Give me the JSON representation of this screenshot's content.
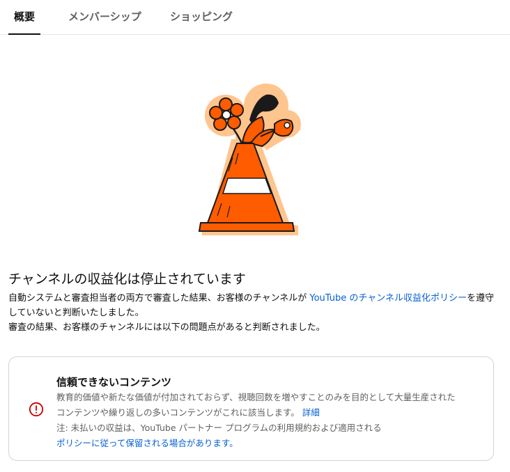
{
  "tabs": [
    {
      "label": "概要",
      "active": true
    },
    {
      "label": "メンバーシップ",
      "active": false
    },
    {
      "label": "ショッピング",
      "active": false
    }
  ],
  "illustration": {
    "icon": "traffic-cone-with-flowers-icon"
  },
  "main": {
    "heading": "チャンネルの収益化は停止されています",
    "desc_part1": "自動システムと審査担当者の両方で審査した結果、お客様のチャンネルが ",
    "policy_link": "YouTube のチャンネル収益化ポリシー",
    "desc_part2": "を遵守していないと判断いたしました。",
    "desc_line3": "審査の結果、お客様のチャンネルには以下の問題点があると判断されました。"
  },
  "issue_card": {
    "title": "信頼できないコンテンツ",
    "body_line1": "教育的価値や新たな価値が付加されておらず、視聴回数を増やすことのみを目的として大量生産された",
    "body_line2": "コンテンツや繰り返しの多いコンテンツがこれに該当します。",
    "detail_link": "詳細",
    "note_line1": "注: 未払いの収益は、YouTube パートナー プログラムの利用規約および適用される",
    "note_link": "ポリシーに従って保留される場合があります。",
    "icon": "alert-circle-icon",
    "icon_color": "#cc0000"
  },
  "colors": {
    "link": "#065fd4",
    "secondary_text": "#606060",
    "cone_orange": "#ff5c00",
    "halo": "#ffc58f"
  }
}
